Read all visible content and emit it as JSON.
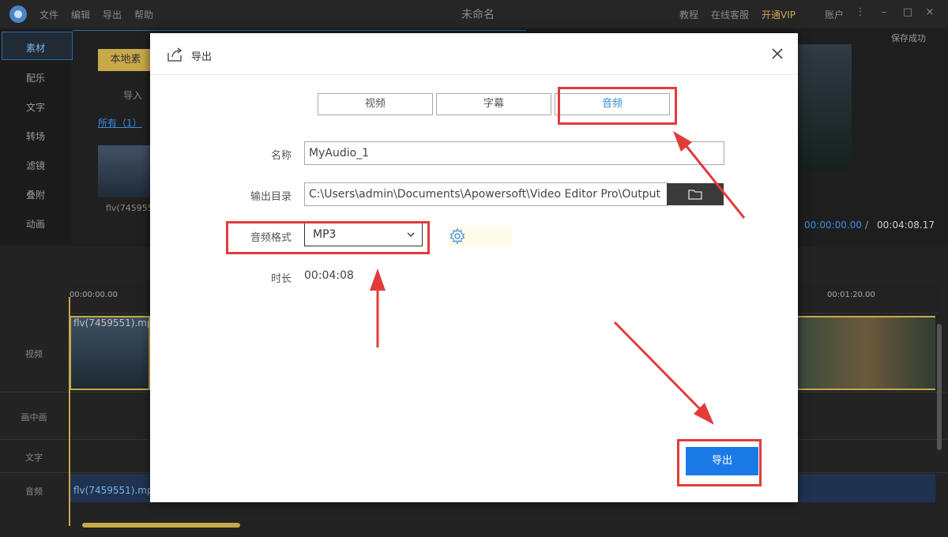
{
  "app": {
    "title": "未命名",
    "menu": [
      "文件",
      "编辑",
      "导出",
      "帮助"
    ],
    "top_links": [
      "教程",
      "在线客服",
      "开通VIP",
      "账户"
    ],
    "accent_color": "#2c6aa8",
    "vip_color": "#c8a94a"
  },
  "left_nav": {
    "items": [
      "素材",
      "配乐",
      "文字",
      "转场",
      "滤镜",
      "叠附",
      "动画"
    ]
  },
  "media": {
    "local_button": "本地素",
    "import_label": "导入",
    "filter_all": "所有（1）",
    "thumb_name": "flv(745955"
  },
  "preview": {
    "save_status": "保存成功",
    "current_time": "00:00:00.00",
    "separator": "/",
    "total_time": "00:04:08.17"
  },
  "timeline": {
    "ruler_start": "00:00:00.00",
    "ruler_mark": "00:01:20.00",
    "tracks": [
      "视频",
      "画中画",
      "文字",
      "音频"
    ],
    "video_clip_name": "flv(7459551).mp",
    "audio_clip_name": "flv(7459551).mp"
  },
  "dialog": {
    "title": "导出",
    "tabs": [
      "视频",
      "字幕",
      "音频"
    ],
    "active_tab": 2,
    "name_label": "名称",
    "name_value": "MyAudio_1",
    "output_dir_label": "输出目录",
    "output_dir_value": "C:\\Users\\admin\\Documents\\Apowersoft\\Video Editor Pro\\Output",
    "format_label": "音频格式",
    "format_value": "MP3",
    "duration_label": "时长",
    "duration_value": "00:04:08",
    "export_button": "导出",
    "export_color": "#1b7be6",
    "highlight_color": "#e23b3b"
  }
}
